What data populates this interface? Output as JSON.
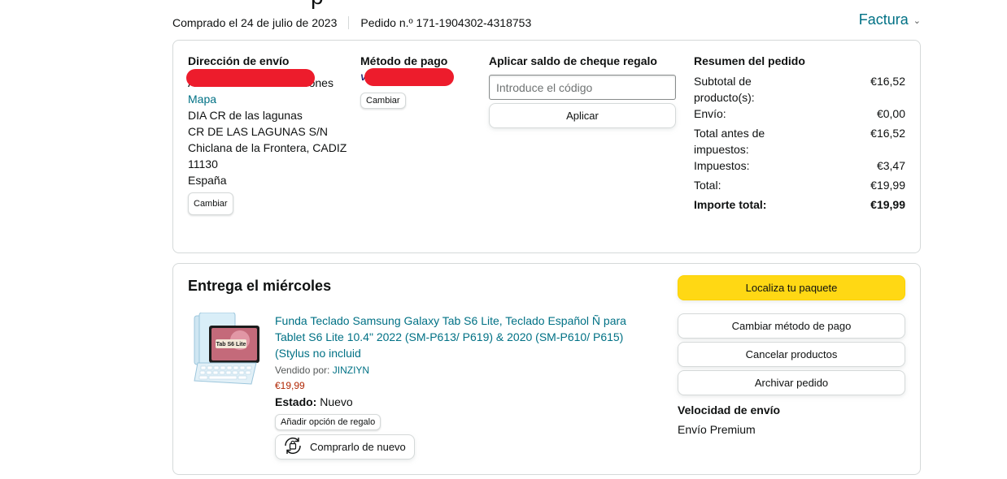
{
  "header": {
    "purchase_date": "Comprado el 24 de julio de 2023",
    "order_number": "Pedido n.º 171-1904302-4318753",
    "invoice_label": "Factura",
    "title_fragment": "p"
  },
  "shipping": {
    "title": "Dirección de envío",
    "line1": "Amazon Locker - camarones",
    "map_link": "Mapa",
    "line2": "DIA CR de las lagunas",
    "line3": "CR DE LAS LAGUNAS S/N",
    "line4": "Chiclana de la Frontera, CADIZ",
    "line5": "11130",
    "line6": "España",
    "change_label": "Cambiar"
  },
  "payment": {
    "title": "Método de pago",
    "card_brand": "VI",
    "change_label": "Cambiar"
  },
  "gift_card": {
    "title": "Aplicar saldo de cheque regalo",
    "placeholder": "Introduce el código",
    "apply_label": "Aplicar"
  },
  "summary": {
    "title": "Resumen del pedido",
    "rows": [
      {
        "label": "Subtotal de producto(s):",
        "value": "€16,52"
      },
      {
        "label": "Envío:",
        "value": "€0,00"
      },
      {
        "label": "Total antes de impuestos:",
        "value": "€16,52"
      },
      {
        "label": "Impuestos:",
        "value": "€3,47"
      },
      {
        "label": "Total:",
        "value": "€19,99"
      },
      {
        "label": "Importe total:",
        "value": "€19,99"
      }
    ]
  },
  "delivery": {
    "title": "Entrega el miércoles",
    "product_title": "Funda Teclado Samsung Galaxy Tab S6 Lite, Teclado Español Ñ para Tablet S6 Lite 10.4\" 2022 (SM-P613/ P619) & 2020 (SM-P610/ P615) (Stylus no incluid",
    "image_label": "Tab S6 Lite",
    "sold_by_label": "Vendido por: ",
    "seller": "JINZIYN",
    "price": "€19,99",
    "status_label": "Estado:",
    "status_value": " Nuevo",
    "gift_option": "Añadir opción de regalo",
    "buy_again": "Comprarlo de nuevo",
    "actions": {
      "track": "Localiza tu paquete",
      "change_payment": "Cambiar método de pago",
      "cancel": "Cancelar productos",
      "archive": "Archivar pedido"
    },
    "speed_title": "Velocidad de envío",
    "speed_value": "Envío Premium"
  },
  "colors": {
    "link": "#007185",
    "price": "#b12704",
    "primary_button": "#ffd814",
    "redaction": "#ed1c2c"
  }
}
